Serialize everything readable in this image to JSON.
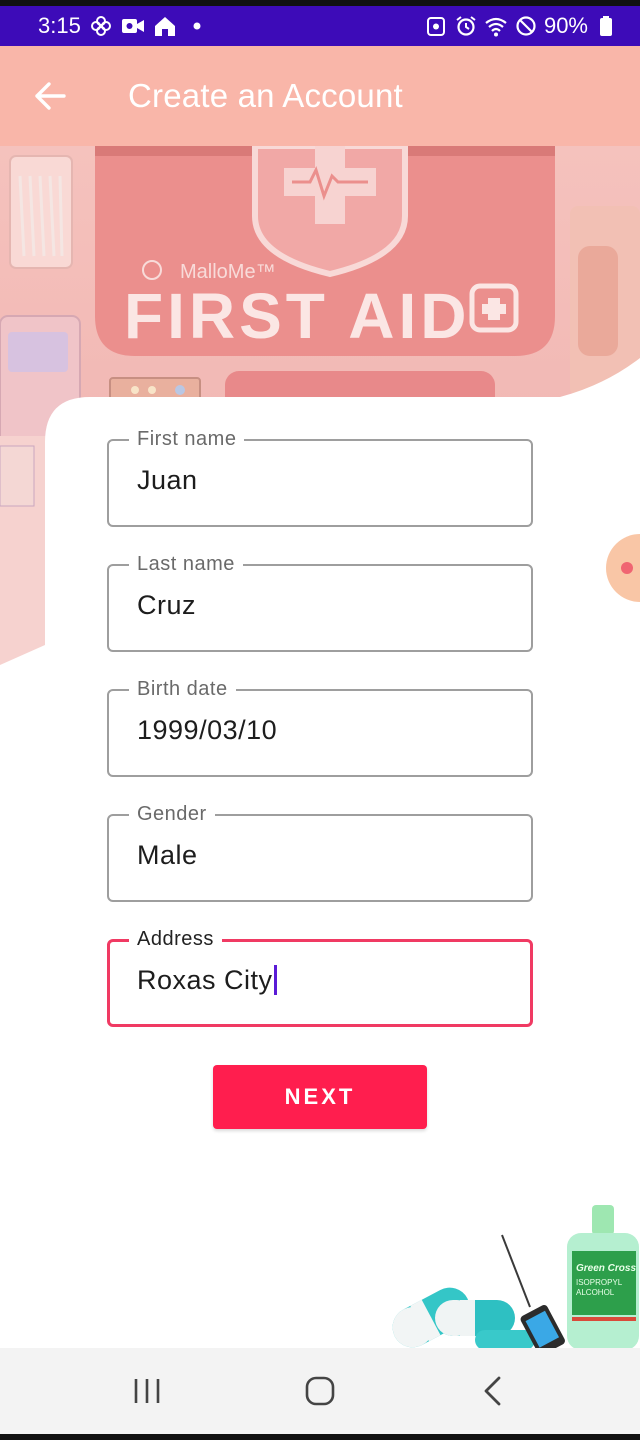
{
  "status_bar": {
    "time": "3:15",
    "battery": "90%",
    "icons_left": [
      "pinwheel-icon",
      "video-camera-icon",
      "home-icon",
      "dot-icon"
    ],
    "icons_right": [
      "data-saver-icon",
      "alarm-icon",
      "wifi-icon",
      "do-not-disturb-icon",
      "battery-icon"
    ]
  },
  "app_bar": {
    "title": "Create an Account",
    "back_icon": "arrow-left-icon",
    "background": "#f9b6a9"
  },
  "hero": {
    "brand": "MalloMe™",
    "kit_text": "FIRST AID"
  },
  "form": {
    "fields": [
      {
        "label": "First name",
        "value": "Juan"
      },
      {
        "label": "Last name",
        "value": "Cruz"
      },
      {
        "label": "Birth date",
        "value": "1999/03/10"
      },
      {
        "label": "Gender",
        "value": "Male"
      },
      {
        "label": "Address",
        "value": "Roxas City",
        "focused": true
      }
    ],
    "next_label": "NEXT",
    "accent": "#ff1e4e"
  },
  "decoration": {
    "bottle_brand": "Green Cross",
    "bottle_line1": "ISOPROPYL",
    "bottle_line2": "ALCOHOL"
  },
  "nav_bar": {
    "buttons": [
      "recent-apps-icon",
      "home-circle-icon",
      "back-chevron-icon"
    ]
  }
}
